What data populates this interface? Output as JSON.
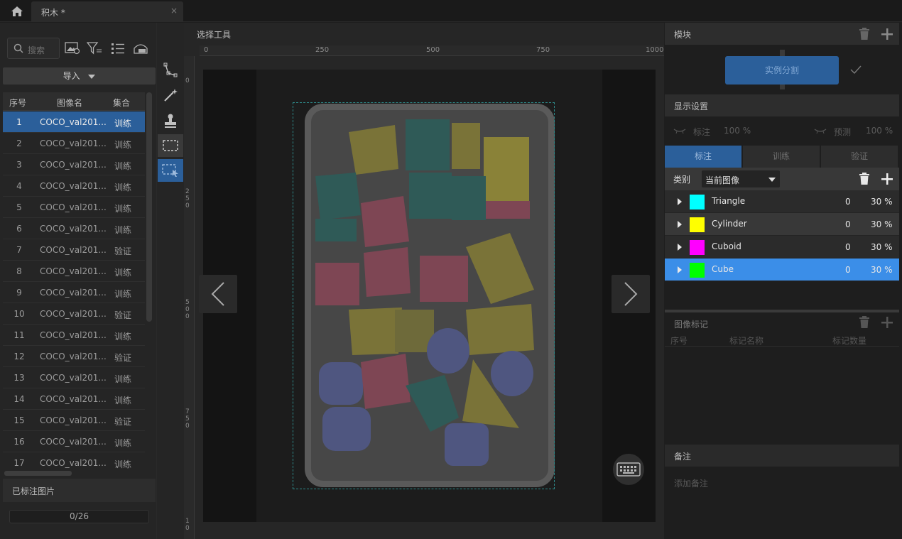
{
  "tabbar": {
    "doc_title": "积木 *",
    "close": "×"
  },
  "left": {
    "search_placeholder": "搜索",
    "import_label": "导入",
    "columns": {
      "index": "序号",
      "name": "图像名",
      "set": "集合"
    },
    "rows": [
      {
        "index": "1",
        "name": "COCO_val201...",
        "set": "训练"
      },
      {
        "index": "2",
        "name": "COCO_val201...",
        "set": "训练"
      },
      {
        "index": "3",
        "name": "COCO_val201...",
        "set": "训练"
      },
      {
        "index": "4",
        "name": "COCO_val201...",
        "set": "训练"
      },
      {
        "index": "5",
        "name": "COCO_val201...",
        "set": "训练"
      },
      {
        "index": "6",
        "name": "COCO_val201...",
        "set": "训练"
      },
      {
        "index": "7",
        "name": "COCO_val201...",
        "set": "验证"
      },
      {
        "index": "8",
        "name": "COCO_val201...",
        "set": "训练"
      },
      {
        "index": "9",
        "name": "COCO_val201...",
        "set": "训练"
      },
      {
        "index": "10",
        "name": "COCO_val201...",
        "set": "验证"
      },
      {
        "index": "11",
        "name": "COCO_val201...",
        "set": "训练"
      },
      {
        "index": "12",
        "name": "COCO_val201...",
        "set": "验证"
      },
      {
        "index": "13",
        "name": "COCO_val201...",
        "set": "训练"
      },
      {
        "index": "14",
        "name": "COCO_val201...",
        "set": "训练"
      },
      {
        "index": "15",
        "name": "COCO_val201...",
        "set": "验证"
      },
      {
        "index": "16",
        "name": "COCO_val201...",
        "set": "训练"
      },
      {
        "index": "17",
        "name": "COCO_val201...",
        "set": "训练"
      }
    ],
    "labeled_header": "已标注图片",
    "progress_text": "0/26",
    "progress_fraction": 0
  },
  "canvas": {
    "select_tool_label": "选择工具",
    "ruler_top": [
      "0",
      "250",
      "500",
      "750",
      "1000"
    ],
    "ruler_left": [
      "0",
      "2 5 0",
      "5 0 0",
      "7 5 0",
      "1 0"
    ]
  },
  "right": {
    "module_header": "模块",
    "module_button": "实例分割",
    "display_header": "显示设置",
    "display_label_text": "标注",
    "display_label_pct": "100 %",
    "display_pred_text": "预测",
    "display_pred_pct": "100 %",
    "tabs": [
      "标注",
      "训练",
      "验证"
    ],
    "category_label": "类别",
    "category_select": "当前图像",
    "categories": [
      {
        "name": "Triangle",
        "color": "#00ffff",
        "count": "0",
        "pct": "30 %"
      },
      {
        "name": "Cylinder",
        "color": "#ffff00",
        "count": "0",
        "pct": "30 %"
      },
      {
        "name": "Cuboid",
        "color": "#ff00ff",
        "count": "0",
        "pct": "30 %"
      },
      {
        "name": "Cube",
        "color": "#00ff00",
        "count": "0",
        "pct": "30 %"
      }
    ],
    "image_marks_header": "图像标记",
    "mark_columns": [
      "序号",
      "标记名称",
      "标记数量"
    ],
    "notes_header": "备注",
    "notes_placeholder": "添加备注"
  }
}
